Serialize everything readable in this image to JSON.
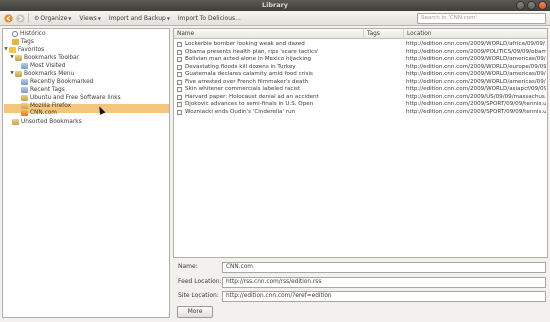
{
  "window": {
    "title": "Library"
  },
  "toolbar": {
    "organize_label": "Organize",
    "views_label": "Views",
    "import_backup_label": "Import and Backup",
    "import_delicious_label": "Import To Delicious...",
    "search_placeholder": "Search in 'CNN.com'"
  },
  "sidebar": {
    "items": [
      {
        "label": "Histórico",
        "icon": "history-icon"
      },
      {
        "label": "Tags",
        "icon": "tag-icon"
      },
      {
        "label": "Favoritos",
        "icon": "star-icon"
      },
      {
        "label": "Bookmarks Toolbar",
        "icon": "folder-icon"
      },
      {
        "label": "Most Visited",
        "icon": "query-icon"
      },
      {
        "label": "Bookmarks Menu",
        "icon": "folder-icon"
      },
      {
        "label": "Recently Bookmarked",
        "icon": "query-icon"
      },
      {
        "label": "Recent Tags",
        "icon": "query-icon"
      },
      {
        "label": "Ubuntu and Free Software links",
        "icon": "folder-icon"
      },
      {
        "label": "Mozilla Firefox",
        "icon": "folder-icon"
      },
      {
        "label": "CNN.com",
        "icon": "live-bookmark-icon"
      },
      {
        "label": "Unsorted Bookmarks",
        "icon": "folder-icon"
      }
    ]
  },
  "list": {
    "columns": {
      "name": "Name",
      "tags": "Tags",
      "location": "Location"
    },
    "rows": [
      {
        "name": "Lockerbie bomber looking weak and dazed",
        "location": "http://edition.cnn.com/2009/WORLD/africa/09/09/..."
      },
      {
        "name": "Obama presents health plan, rips 'scare tactics'",
        "location": "http://edition.cnn.com/2009/POLITICS/09/09/obam..."
      },
      {
        "name": "Bolivian man acted alone in Mexico hijacking",
        "location": "http://edition.cnn.com/2009/WORLD/americas/09/0..."
      },
      {
        "name": "Devastating floods kill dozens in Turkey",
        "location": "http://edition.cnn.com/2009/WORLD/europe/09/09/..."
      },
      {
        "name": "Guatemala declares calamity amid food crisis",
        "location": "http://edition.cnn.com/2009/WORLD/americas/09/..."
      },
      {
        "name": "Five arrested over French filmmaker's death",
        "location": "http://edition.cnn.com/2009/WORLD/americas/09/0..."
      },
      {
        "name": "Skin whitener commercials labeled racist",
        "location": "http://edition.cnn.com/2009/WORLD/asiapcf/09/09/..."
      },
      {
        "name": "Harvard paper: Holocaust denial ad an accident",
        "location": "http://edition.cnn.com/2009/US/09/09/massachus..."
      },
      {
        "name": "Djokovic advances to semi-finals in U.S. Open",
        "location": "http://edition.cnn.com/2009/SPORT/09/09/tennis.u..."
      },
      {
        "name": "Wozniacki ends Oudin's 'Cinderella' run",
        "location": "http://edition.cnn.com/2009/SPORT/09/09/tennis.u..."
      }
    ]
  },
  "details": {
    "name_label": "Name:",
    "name_value": "CNN.com",
    "feed_label": "Feed Location:",
    "feed_value": "http://rss.cnn.com/rss/edition.rss",
    "site_label": "Site Location:",
    "site_value": "http://edition.cnn.com/?eref=edition",
    "more_label": "More"
  }
}
